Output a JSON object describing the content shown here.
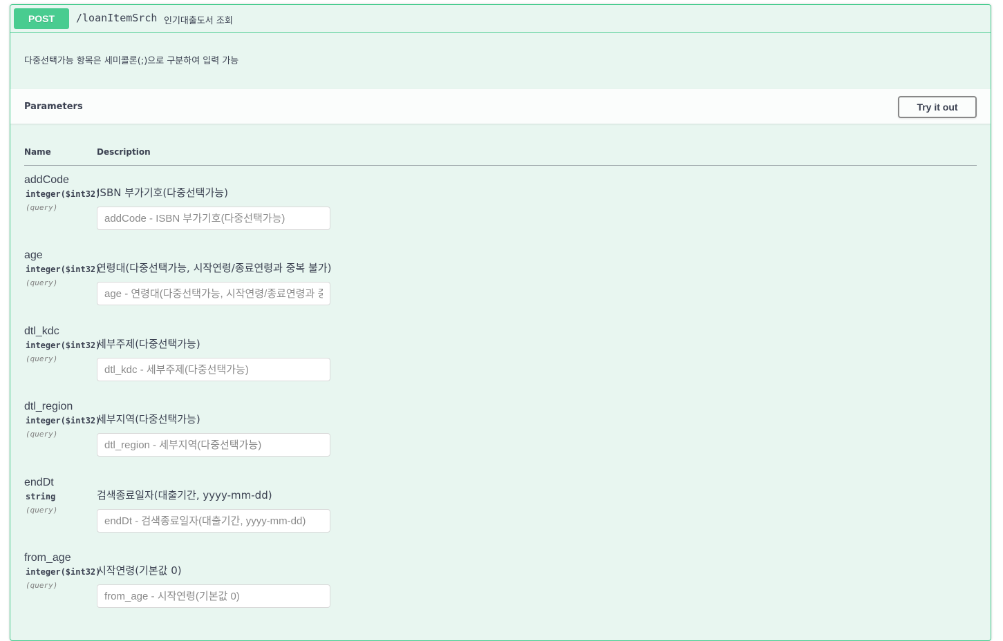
{
  "operation": {
    "method": "POST",
    "path": "/loanItemSrch",
    "summary": "인기대출도서 조회",
    "description": "다중선택가능 항목은 세미콜론(;)으로 구분하여 입력 가능"
  },
  "parameters_section": {
    "title": "Parameters",
    "try_button": "Try it out",
    "col_name": "Name",
    "col_description": "Description"
  },
  "params": [
    {
      "name": "addCode",
      "type": "integer($int32)",
      "in": "(query)",
      "description": "ISBN 부가기호(다중선택가능)",
      "placeholder": "addCode - ISBN 부가기호(다중선택가능)"
    },
    {
      "name": "age",
      "type": "integer($int32)",
      "in": "(query)",
      "description": "연령대(다중선택가능, 시작연령/종료연령과 중복 불가)",
      "placeholder": "age - 연령대(다중선택가능, 시작연령/종료연령과 중복 불가)"
    },
    {
      "name": "dtl_kdc",
      "type": "integer($int32)",
      "in": "(query)",
      "description": "세부주제(다중선택가능)",
      "placeholder": "dtl_kdc - 세부주제(다중선택가능)"
    },
    {
      "name": "dtl_region",
      "type": "integer($int32)",
      "in": "(query)",
      "description": "세부지역(다중선택가능)",
      "placeholder": "dtl_region - 세부지역(다중선택가능)"
    },
    {
      "name": "endDt",
      "type": "string",
      "in": "(query)",
      "description": "검색종료일자(대출기간, yyyy-mm-dd)",
      "placeholder": "endDt - 검색종료일자(대출기간, yyyy-mm-dd)"
    },
    {
      "name": "from_age",
      "type": "integer($int32)",
      "in": "(query)",
      "description": "시작연령(기본값 0)",
      "placeholder": "from_age - 시작연령(기본값 0)"
    }
  ],
  "colors": {
    "post_accent": "#49cc90",
    "block_bg": "#e8f6f0",
    "text": "#3b4151"
  }
}
